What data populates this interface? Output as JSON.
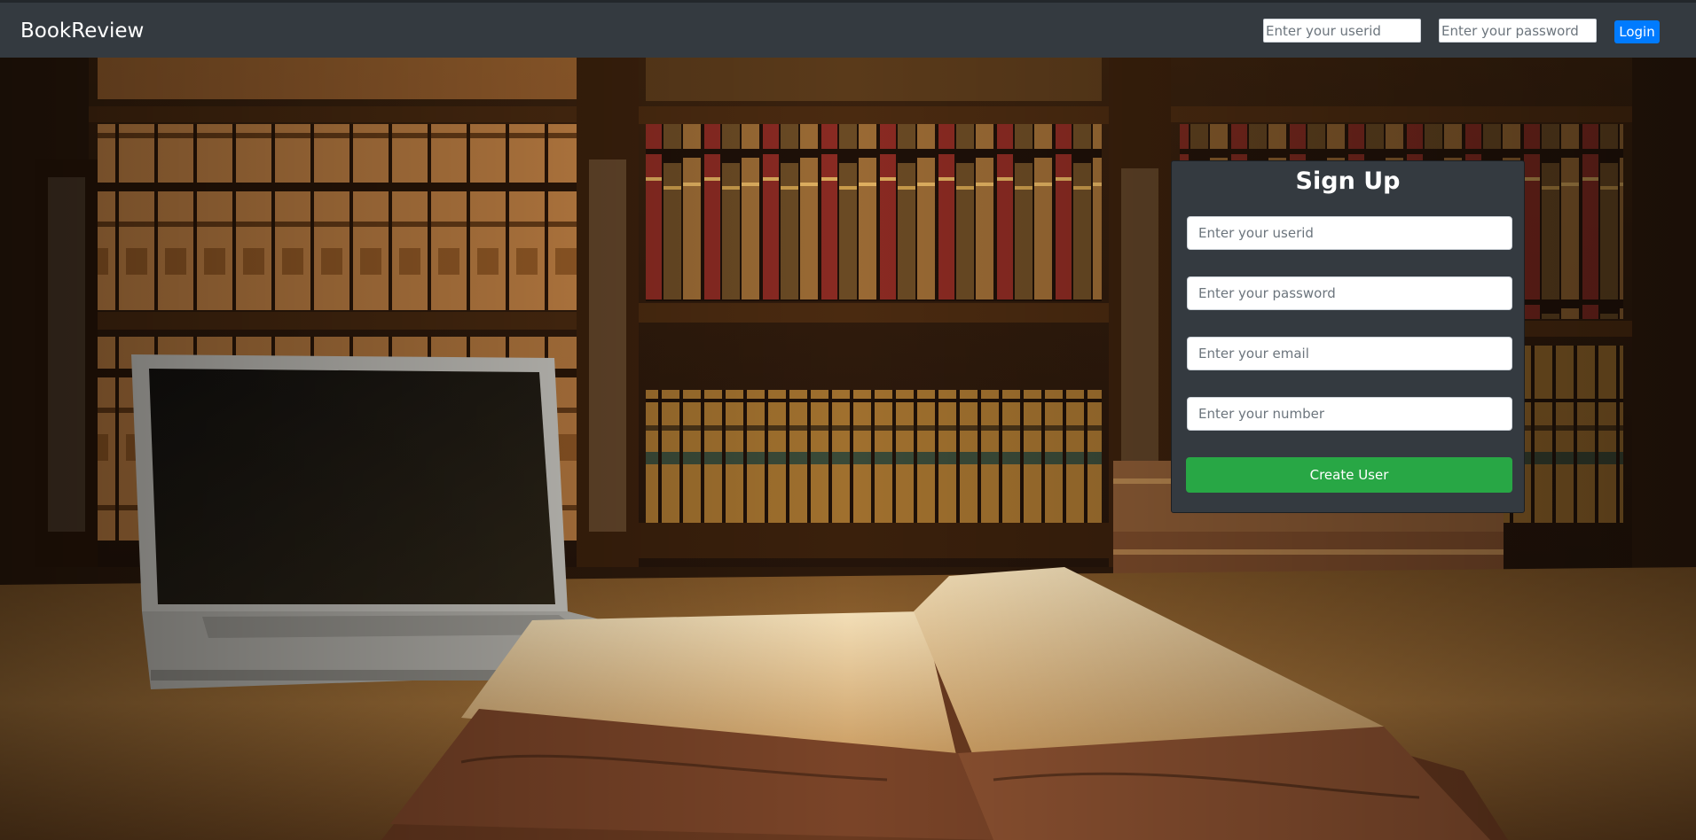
{
  "navbar": {
    "brand": "BookReview",
    "userid_placeholder": "Enter your userid",
    "password_placeholder": "Enter your password",
    "login_label": "Login"
  },
  "signup": {
    "title": "Sign Up",
    "userid_placeholder": "Enter your userid",
    "password_placeholder": "Enter your password",
    "email_placeholder": "Enter your email",
    "number_placeholder": "Enter your number",
    "submit_label": "Create User"
  },
  "colors": {
    "navbar_bg": "#343a40",
    "login_button": "#007bff",
    "create_button": "#28a745",
    "card_bg": "#343a40"
  }
}
